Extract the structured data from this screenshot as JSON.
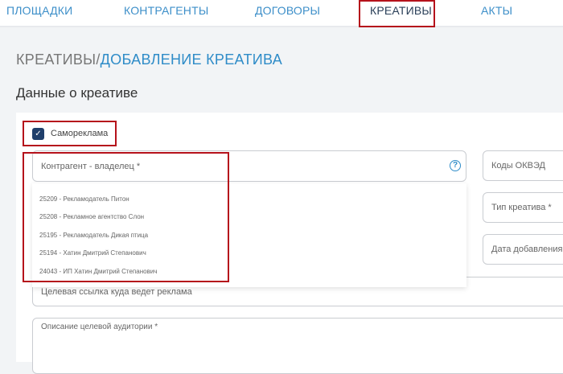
{
  "nav": {
    "items": [
      {
        "label": "ПЛОЩАДКИ"
      },
      {
        "label": "КОНТРАГЕНТЫ"
      },
      {
        "label": "ДОГОВОРЫ"
      },
      {
        "label": "КРЕАТИВЫ",
        "active": true
      },
      {
        "label": "АКТЫ"
      }
    ]
  },
  "breadcrumb": {
    "parent": "КРЕАТИВЫ/",
    "current": "ДОБАВЛЕНИЕ КРЕАТИВА"
  },
  "section_title": "Данные о креативе",
  "form": {
    "self_ad": {
      "label": "Самореклама",
      "checked": true
    },
    "owner": {
      "placeholder": "Контрагент - владелец *",
      "options": [
        "25209 - Рекламодатель Питон",
        "25208 - Рекламное агентство Слон",
        "25195 - Рекламодатель Дикая птица",
        "25194 - Хатин Дмитрий Степанович",
        "24043 - ИП Хатин Дмитрий Степанович"
      ]
    },
    "okved": "Коды ОКВЭД",
    "creative_type": "Тип креатива *",
    "date_added": "Дата добавления",
    "target_url": "Целевая ссылка куда ведет реклама",
    "audience": "Описание целевой аудитории *"
  },
  "colors": {
    "accent": "#2f8cc8",
    "highlight": "#b5121b",
    "checkbox": "#1f3f6b"
  }
}
